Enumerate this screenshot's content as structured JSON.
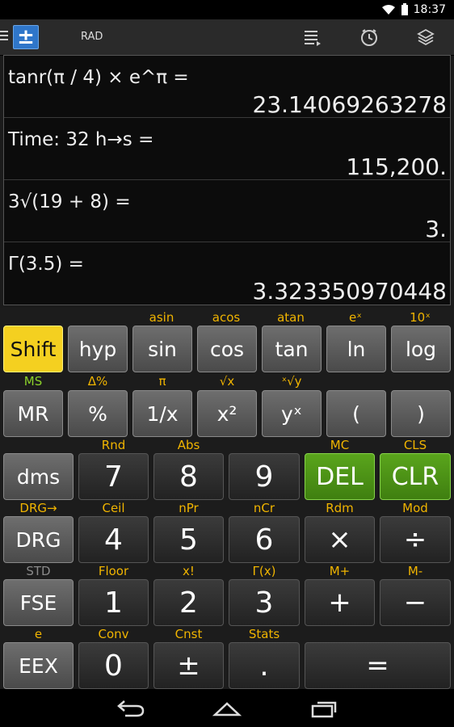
{
  "status": {
    "time": "18:37"
  },
  "actionbar": {
    "mode": "RAD"
  },
  "history": [
    {
      "expr": "tanr(π / 4) × e^π =",
      "result": "23.14069263278"
    },
    {
      "expr": "Time: 32 h→s =",
      "result": "115,200."
    },
    {
      "expr": "3√(19 + 8) =",
      "result": "3."
    },
    {
      "expr": "Γ(3.5) =",
      "result": "3.323350970448"
    }
  ],
  "keys": {
    "r1": [
      "Shift",
      "hyp",
      "sin",
      "cos",
      "tan",
      "ln",
      "log"
    ],
    "r1_labels": [
      "asin",
      "acos",
      "atan",
      "eˣ",
      "10ˣ"
    ],
    "r2": [
      "MR",
      "%",
      "1/x",
      "x²",
      "yˣ",
      "(",
      ")"
    ],
    "r2_labels": [
      "MS",
      "Δ%",
      "π",
      "√x",
      "ˣ√y"
    ],
    "r3": [
      "dms",
      "7",
      "8",
      "9",
      "DEL",
      "CLR"
    ],
    "r3_labels": [
      "Rnd",
      "Abs",
      "MC",
      "CLS"
    ],
    "r4": [
      "DRG",
      "4",
      "5",
      "6",
      "×",
      "÷"
    ],
    "r4_labels": [
      "DRG→",
      "Ceil",
      "nPr",
      "nCr",
      "Rdm",
      "Mod"
    ],
    "r5": [
      "FSE",
      "1",
      "2",
      "3",
      "+",
      "−"
    ],
    "r5_labels": [
      "STD",
      "Floor",
      "x!",
      "Γ(x)",
      "M+",
      "M-"
    ],
    "r6": [
      "EEX",
      "0",
      "±",
      ".",
      "="
    ],
    "r6_labels": [
      "e",
      "Conv",
      "Cnst",
      "Stats"
    ]
  },
  "colors": {
    "shift": "#f4d020",
    "accent_label": "#f0b400",
    "green_label": "#8bd12a",
    "green_key": "#4c9216"
  }
}
